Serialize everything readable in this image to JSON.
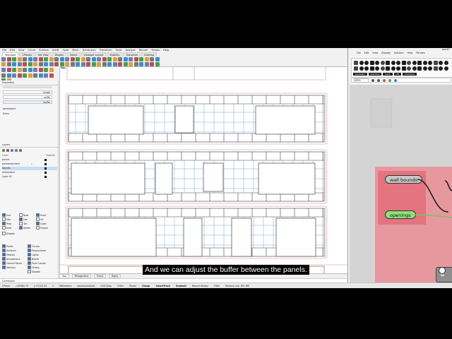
{
  "rhino": {
    "menu": [
      "File",
      "Edit",
      "View",
      "Curve",
      "Surface",
      "SubD",
      "Solid",
      "Mesh",
      "Dimension",
      "Transform",
      "Tools",
      "Analyze",
      "Render",
      "Panels",
      "Help"
    ],
    "tabs": [
      "Standard",
      "CPlanes",
      "Set View",
      "Display",
      "Select",
      "Viewport Layout",
      "Visibility",
      "Transform",
      "Drafting"
    ],
    "active_tab": "Standard",
    "viewport_label": "Top",
    "viewport_tabs": [
      "Top",
      "Perspective",
      "Front",
      "Right"
    ],
    "left_panel": {
      "tabs": [
        "Properties",
        "Layers",
        "Display"
      ],
      "prop_fields": [
        "height",
        "width",
        "buffer"
      ],
      "extra_labels": [
        "panelspace",
        "Extra"
      ],
      "layers_header": [
        "Layer",
        "Material"
      ],
      "layers": [
        {
          "name": "panels",
          "check": ""
        },
        {
          "name": "panelsconsilent",
          "check": "✓"
        },
        {
          "name": "bounds",
          "check": ""
        },
        {
          "name": "dimensions",
          "check": ""
        },
        {
          "name": "Layer 01",
          "check": ""
        }
      ],
      "osnap_rows": [
        [
          "End",
          "Near",
          "Point"
        ],
        [
          "Mid",
          "Cen",
          "Int"
        ],
        [
          "Perp",
          "Tan",
          "Quad"
        ],
        [
          "Knot",
          "Vertex",
          "Project"
        ]
      ],
      "osnap_disable": "Disable",
      "select_filter": [
        "Points",
        "Curves",
        "Surfaces",
        "Polysurfaces",
        "Meshes",
        "Lights",
        "Annotations",
        "Blocks",
        "Control Points",
        "Point Clouds",
        "Hatches",
        "Others"
      ],
      "select_disable": "Disable"
    },
    "cmdline_prompt": "Command:",
    "status": {
      "cplane": "CPlane",
      "x": "x 63482.70",
      "y": "y 27122.03",
      "z": "z",
      "units": "Millimeters",
      "layer": "panelsconsilent",
      "grid_snap": "Grid Snap",
      "ortho": "Ortho",
      "planar": "Planar",
      "osnap": "Osnap",
      "smarttrack": "SmartTrack",
      "gumball": "Gumball",
      "record_history": "Record History",
      "filter": "Filter",
      "memory": "Memory use: 891 MB"
    }
  },
  "grasshopper": {
    "menu": [
      "File",
      "Edit",
      "View",
      "Display",
      "Solution",
      "Help",
      "Params"
    ],
    "window_label": "panel*",
    "zoom": "63%",
    "tool_tabs": [
      "Geometry",
      "Primitive",
      "Input",
      "Util",
      "Enclosure"
    ],
    "params": {
      "wall_bounds": "wall bounds",
      "openings": "openings"
    },
    "component_label": "G",
    "colors": {
      "group": "#e98f96",
      "param_gray": "#c8c8c8",
      "param_green": "#8fe07a"
    }
  },
  "subtitle": "And we can adjust the buffer between the panels."
}
